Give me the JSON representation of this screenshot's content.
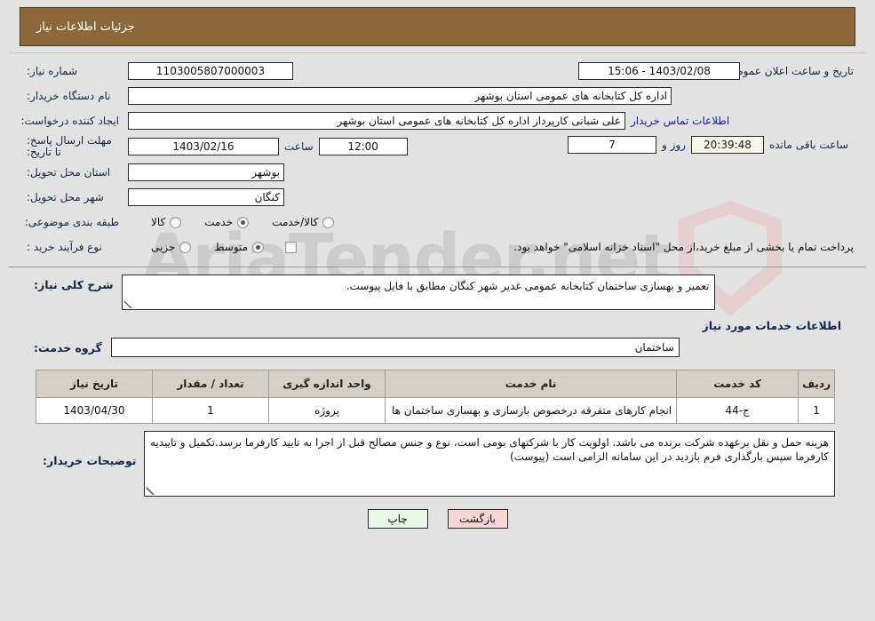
{
  "watermark": {
    "text": "AriaTender.net"
  },
  "header": {
    "title": "جزئیات اطلاعات نیاز"
  },
  "form": {
    "need_number": {
      "label": "شماره نیاز:",
      "value": "1103005807000003"
    },
    "public_announce": {
      "label": "تاریخ و ساعت اعلان عمومی:",
      "value": "15:06 - 1403/02/08"
    },
    "buyer_org": {
      "label": "نام دستگاه خریدار:",
      "value": "اداره کل کتابخانه های عمومی استان بوشهر"
    },
    "creator": {
      "label": "ایجاد کننده درخواست:",
      "value": "علی شبانی کارپرداز اداره کل کتابخانه های عمومی استان بوشهر"
    },
    "contact_link": {
      "label": "اطلاعات تماس خریدار"
    },
    "deadline": {
      "label": "مهلت ارسال پاسخ: تا تاریخ:",
      "date": "1403/02/16",
      "time_label": "ساعت",
      "time": "12:00",
      "days": "7",
      "days_label": "روز و",
      "countdown": "20:39:48",
      "remaining_label": "ساعت باقی مانده"
    },
    "province": {
      "label": "استان محل تحویل:",
      "value": "بوشهر"
    },
    "city": {
      "label": "شهر محل تحویل:",
      "value": "کنگان"
    },
    "category": {
      "label": "طبقه بندی موضوعی:",
      "options": [
        {
          "label": "کالا",
          "selected": false
        },
        {
          "label": "خدمت",
          "selected": true
        },
        {
          "label": "کالا/خدمت",
          "selected": false
        }
      ]
    },
    "purchase_type": {
      "label": "نوع فرآیند خرید :",
      "options": [
        {
          "label": "جزیی",
          "selected": false
        },
        {
          "label": "متوسط",
          "selected": true
        }
      ],
      "checkbox": {
        "label": "پرداخت تمام یا بخشی از مبلغ خرید،از محل \"اسناد خزانه اسلامی\" خواهد بود.",
        "checked": false
      }
    }
  },
  "description": {
    "label": "شرح کلی نیاز:",
    "value": "تعمیر و بهسازی ساختمان کتابخانه عمومی غدیر شهر کنگان مطابق با فایل پیوست."
  },
  "services": {
    "section_title": "اطلاعات خدمات مورد نیاز",
    "group": {
      "label": "گروه خدمت:",
      "value": "ساختمان"
    },
    "table": {
      "columns": [
        "ردیف",
        "کد خدمت",
        "نام خدمت",
        "واحد اندازه گیری",
        "تعداد / مقدار",
        "تاریخ نیاز"
      ],
      "rows": [
        {
          "radif": "1",
          "code": "ج-44",
          "name": "انجام کارهای متفرقه درخصوص بازسازی و بهسازی ساختمان ها",
          "unit": "پروژه",
          "qty": "1",
          "date": "1403/04/30"
        }
      ]
    }
  },
  "notes": {
    "label": "توضیحات خریدار:",
    "value": "هزینه حمل و نقل  برعهده شرکت برنده می باشد. اولویت کار با شرکتهای بومی است، نوع و جنس مصالح قبل از اجرا به تایید کارفرما برسد.تکمیل و تاییدیه کارفرما سپس بارگذاری فرم بازدید در این سامانه الزامی است (پیوست)"
  },
  "footer": {
    "print_label": "چاپ",
    "back_label": "بازگشت"
  },
  "colors": {
    "header_bg": "#8b6739",
    "page_bg": "#e2e2e2",
    "link": "#1414e0",
    "print_btn": "#e9f7e9",
    "back_btn": "#fad5d5",
    "countdown_bg": "#f7f6e8",
    "table_header_bg": "#d4d0c8"
  }
}
